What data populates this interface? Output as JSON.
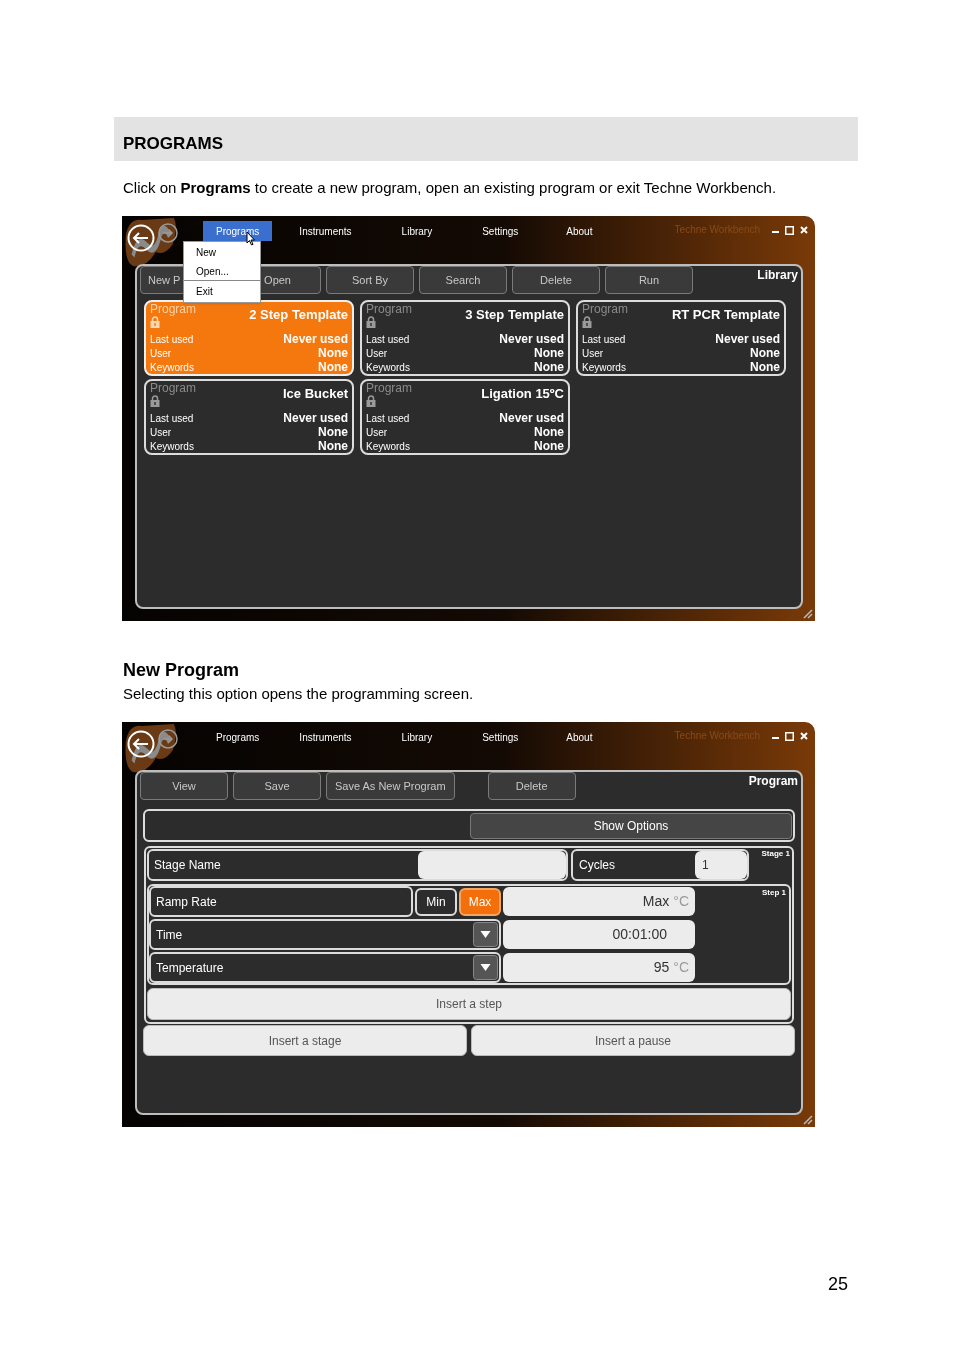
{
  "section_header": "PROGRAMS",
  "intro": "Click on **Programs** to create a new program, open an existing program or exit Techne Workbench.",
  "screens": [
    {
      "kind": "library",
      "title": "Techne Workbench",
      "panel_label": "Library",
      "menu": [
        {
          "label": "Programs",
          "selected": true
        },
        {
          "label": "Instruments",
          "selected": false
        },
        {
          "label": "Library",
          "selected": false
        },
        {
          "label": "Settings",
          "selected": false
        },
        {
          "label": "About",
          "selected": false
        }
      ],
      "open_menu": [
        {
          "label": "New",
          "separator_before": false
        },
        {
          "label": "Open...",
          "separator_before": false
        },
        {
          "label": "Exit",
          "separator_before": true
        }
      ],
      "toolbar": [
        [
          "New P",
          "Open",
          "Sort By",
          "Search",
          "Delete",
          "Run"
        ]
      ],
      "cards": [
        {
          "caption": "Program",
          "title": "2 Step Template",
          "selected": true,
          "rows": [
            [
              "Last used",
              "Never used"
            ],
            [
              "User",
              "None"
            ],
            [
              "Keywords",
              "None"
            ]
          ]
        },
        {
          "caption": "Program",
          "title": "3 Step Template",
          "selected": false,
          "rows": [
            [
              "Last used",
              "Never used"
            ],
            [
              "User",
              "None"
            ],
            [
              "Keywords",
              "None"
            ]
          ]
        },
        {
          "caption": "Program",
          "title": "RT PCR Template",
          "selected": false,
          "rows": [
            [
              "Last used",
              "Never used"
            ],
            [
              "User",
              "None"
            ],
            [
              "Keywords",
              "None"
            ]
          ]
        },
        {
          "caption": "Program",
          "title": "Ice Bucket",
          "selected": false,
          "rows": [
            [
              "Last used",
              "Never used"
            ],
            [
              "User",
              "None"
            ],
            [
              "Keywords",
              "None"
            ]
          ]
        },
        {
          "caption": "Program",
          "title": "Ligation 15ºC",
          "selected": false,
          "rows": [
            [
              "Last used",
              "Never used"
            ],
            [
              "User",
              "None"
            ],
            [
              "Keywords",
              "None"
            ]
          ]
        }
      ]
    },
    {
      "kind": "program",
      "title": "Techne Workbench",
      "panel_label": "Program",
      "menu": [
        {
          "label": "Programs",
          "selected": false
        },
        {
          "label": "Instruments",
          "selected": false
        },
        {
          "label": "Library",
          "selected": false
        },
        {
          "label": "Settings",
          "selected": false
        },
        {
          "label": "About",
          "selected": false
        }
      ],
      "toolbar": [
        [
          "View",
          "Save",
          "Save As New Program"
        ],
        [
          "Delete"
        ]
      ],
      "show_options": "Show Options",
      "stage": {
        "name_label": "Stage Name",
        "cycles_label": "Cycles",
        "cycles": "1",
        "label": "Stage 1"
      },
      "step": {
        "label": "Step 1",
        "rows": [
          {
            "kind": "ramp",
            "label": "Ramp Rate",
            "options": [
              {
                "label": "Min",
                "selected": false
              },
              {
                "label": "Max",
                "selected": true
              }
            ],
            "value": "Max",
            "unit": "°C"
          },
          {
            "kind": "dropdown",
            "label": "Time",
            "value": "00:01:00"
          },
          {
            "kind": "dropdown",
            "label": "Temperature",
            "value": "95",
            "unit": "°C"
          }
        ]
      },
      "insert_step": "Insert a step",
      "bottom_buttons": [
        "Insert a stage",
        "Insert a pause"
      ]
    }
  ],
  "heading": "New Program",
  "description": "Selecting this option opens the programming screen.",
  "page_number": "25"
}
